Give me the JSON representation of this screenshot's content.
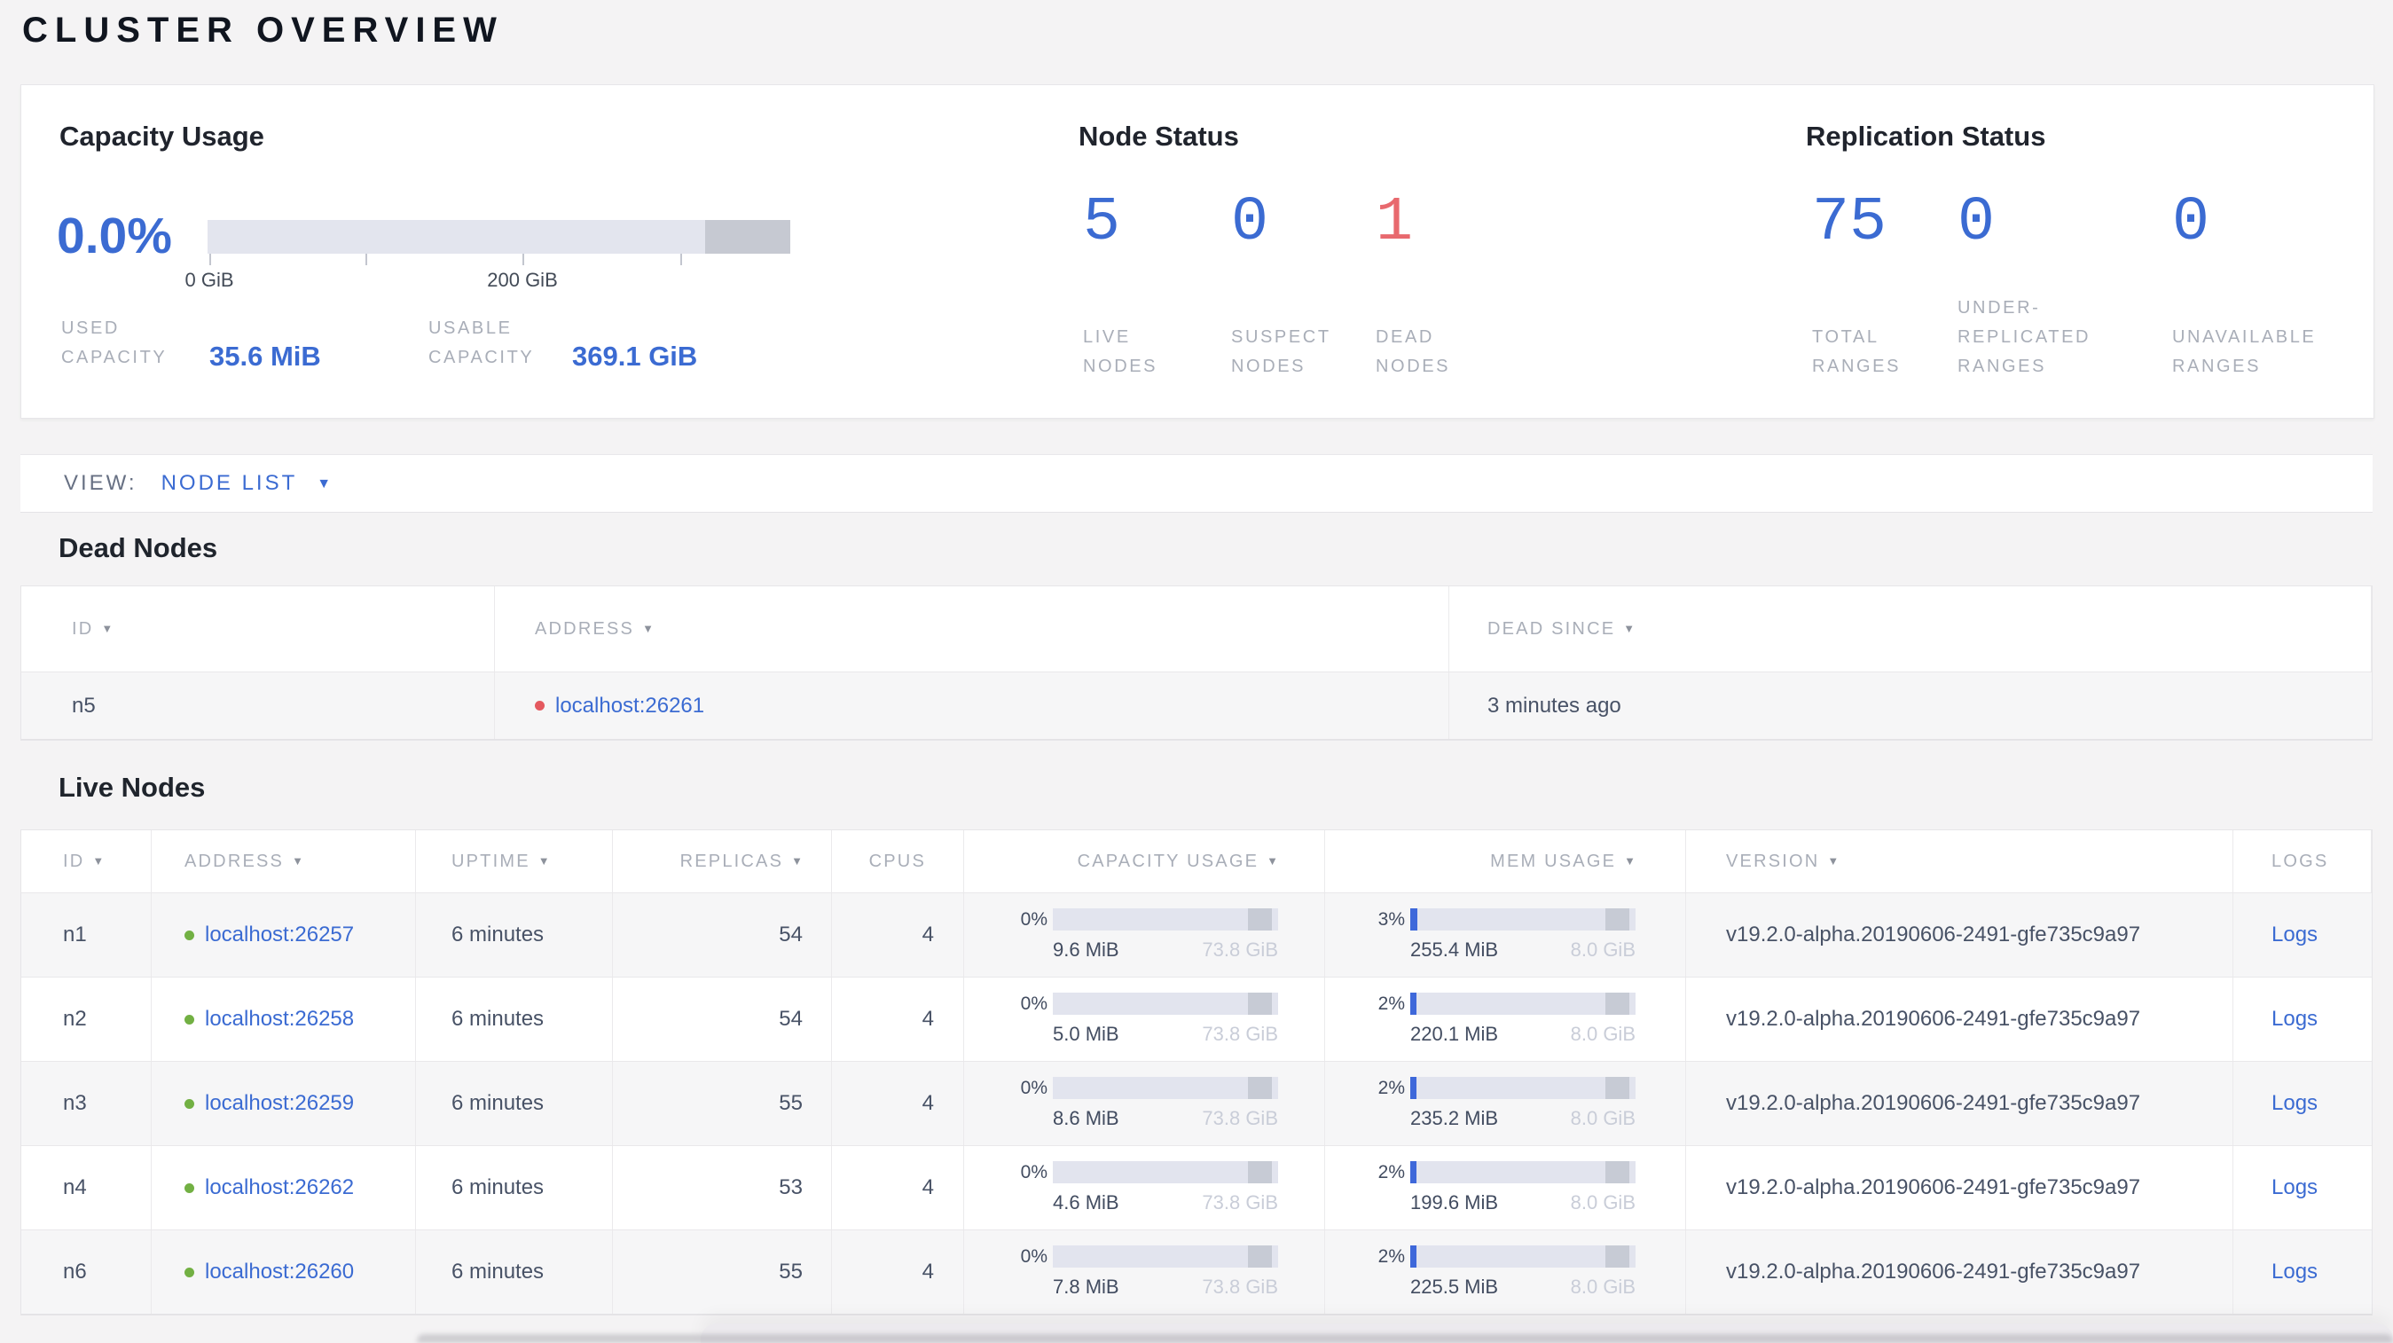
{
  "page_title": "CLUSTER OVERVIEW",
  "colors": {
    "accent_blue": "#3b6bd2",
    "dead_red": "#e8696e",
    "live_green": "#72b043",
    "label_gray": "#a9aeb8",
    "text_slate": "#485266",
    "bar_track": "#e2e4ee",
    "bar_dark_segment": "#c7cbd5",
    "page_background": "#f4f3f4"
  },
  "summary": {
    "capacity": {
      "title": "Capacity Usage",
      "percent": "0.0%",
      "axis_labels": [
        "0 GiB",
        "200 GiB"
      ],
      "used_label": "USED\nCAPACITY",
      "used_value": "35.6 MiB",
      "usable_label": "USABLE\nCAPACITY",
      "usable_value": "369.1 GiB"
    },
    "node_status": {
      "title": "Node Status",
      "stats": [
        {
          "value": "5",
          "lines": [
            "LIVE",
            "NODES"
          ]
        },
        {
          "value": "0",
          "lines": [
            "SUSPECT",
            "NODES"
          ]
        },
        {
          "value": "1",
          "lines": [
            "DEAD",
            "NODES"
          ]
        }
      ]
    },
    "replication": {
      "title": "Replication Status",
      "stats": [
        {
          "value": "75",
          "lines": [
            "TOTAL",
            "RANGES"
          ]
        },
        {
          "value": "0",
          "lines": [
            "UNDER-",
            "REPLICATED",
            "RANGES"
          ]
        },
        {
          "value": "0",
          "lines": [
            "UNAVAILABLE",
            "RANGES"
          ]
        }
      ]
    }
  },
  "view_bar": {
    "label": "VIEW:",
    "selected": "NODE LIST",
    "caret": "▼"
  },
  "dead_nodes": {
    "heading": "Dead Nodes",
    "columns": [
      {
        "label": "ID",
        "caret": "▼"
      },
      {
        "label": "ADDRESS",
        "caret": "▼"
      },
      {
        "label": "DEAD SINCE",
        "caret": "▼"
      }
    ],
    "rows": [
      {
        "id": "n5",
        "address": "localhost:26261",
        "dead_since": "3 minutes ago"
      }
    ]
  },
  "live_nodes": {
    "heading": "Live Nodes",
    "columns": [
      {
        "label": "ID",
        "caret": "▼"
      },
      {
        "label": "ADDRESS",
        "caret": "▼"
      },
      {
        "label": "UPTIME",
        "caret": "▼"
      },
      {
        "label": "REPLICAS",
        "caret": "▼"
      },
      {
        "label": "CPUS",
        "caret": ""
      },
      {
        "label": "CAPACITY USAGE",
        "caret": "▼"
      },
      {
        "label": "MEM USAGE",
        "caret": "▼"
      },
      {
        "label": "VERSION",
        "caret": "▼"
      },
      {
        "label": "LOGS",
        "caret": ""
      }
    ],
    "rows": [
      {
        "id": "n1",
        "address": "localhost:26257",
        "uptime": "6 minutes",
        "replicas": "54",
        "cpus": "4",
        "cap_pct": "0%",
        "cap_pct_val": 0,
        "cap_used": "9.6 MiB",
        "cap_total": "73.8 GiB",
        "mem_pct": "3%",
        "mem_pct_val": 3,
        "mem_used": "255.4 MiB",
        "mem_total": "8.0 GiB",
        "version": "v19.2.0-alpha.20190606-2491-gfe735c9a97",
        "logs": "Logs"
      },
      {
        "id": "n2",
        "address": "localhost:26258",
        "uptime": "6 minutes",
        "replicas": "54",
        "cpus": "4",
        "cap_pct": "0%",
        "cap_pct_val": 0,
        "cap_used": "5.0 MiB",
        "cap_total": "73.8 GiB",
        "mem_pct": "2%",
        "mem_pct_val": 2,
        "mem_used": "220.1 MiB",
        "mem_total": "8.0 GiB",
        "version": "v19.2.0-alpha.20190606-2491-gfe735c9a97",
        "logs": "Logs"
      },
      {
        "id": "n3",
        "address": "localhost:26259",
        "uptime": "6 minutes",
        "replicas": "55",
        "cpus": "4",
        "cap_pct": "0%",
        "cap_pct_val": 0,
        "cap_used": "8.6 MiB",
        "cap_total": "73.8 GiB",
        "mem_pct": "2%",
        "mem_pct_val": 2,
        "mem_used": "235.2 MiB",
        "mem_total": "8.0 GiB",
        "version": "v19.2.0-alpha.20190606-2491-gfe735c9a97",
        "logs": "Logs"
      },
      {
        "id": "n4",
        "address": "localhost:26262",
        "uptime": "6 minutes",
        "replicas": "53",
        "cpus": "4",
        "cap_pct": "0%",
        "cap_pct_val": 0,
        "cap_used": "4.6 MiB",
        "cap_total": "73.8 GiB",
        "mem_pct": "2%",
        "mem_pct_val": 2,
        "mem_used": "199.6 MiB",
        "mem_total": "8.0 GiB",
        "version": "v19.2.0-alpha.20190606-2491-gfe735c9a97",
        "logs": "Logs"
      },
      {
        "id": "n6",
        "address": "localhost:26260",
        "uptime": "6 minutes",
        "replicas": "55",
        "cpus": "4",
        "cap_pct": "0%",
        "cap_pct_val": 0,
        "cap_used": "7.8 MiB",
        "cap_total": "73.8 GiB",
        "mem_pct": "2%",
        "mem_pct_val": 2,
        "mem_used": "225.5 MiB",
        "mem_total": "8.0 GiB",
        "version": "v19.2.0-alpha.20190606-2491-gfe735c9a97",
        "logs": "Logs"
      }
    ]
  }
}
